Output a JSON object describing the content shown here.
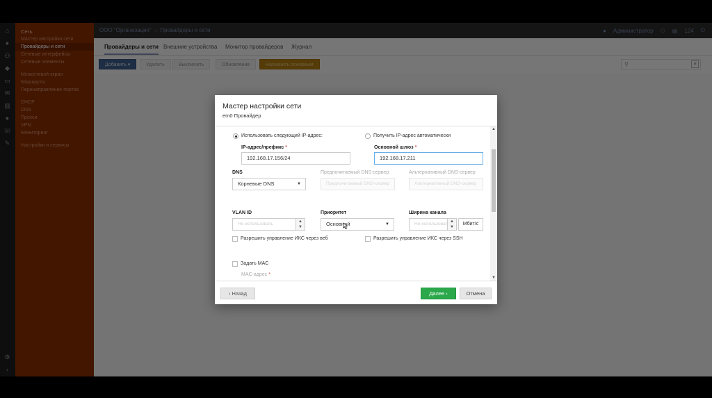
{
  "sidebar": {
    "items": [
      {
        "label": "Сеть",
        "kind": "head"
      },
      {
        "label": "Мастер настройки сети",
        "kind": "item"
      },
      {
        "label": "Провайдеры и сети",
        "kind": "active"
      },
      {
        "label": "Сетевые интерфейсы",
        "kind": "item"
      },
      {
        "label": "Сетевые элементы",
        "kind": "item"
      },
      {
        "label": "",
        "kind": "gap"
      },
      {
        "label": "Межсетевой экран",
        "kind": "item"
      },
      {
        "label": "Маршруты",
        "kind": "item"
      },
      {
        "label": "Перенаправление портов",
        "kind": "item"
      },
      {
        "label": "",
        "kind": "gap"
      },
      {
        "label": "DHCP",
        "kind": "item"
      },
      {
        "label": "DNS",
        "kind": "item"
      },
      {
        "label": "Прокси",
        "kind": "item"
      },
      {
        "label": "VPN",
        "kind": "item"
      },
      {
        "label": "Мониторинг",
        "kind": "item"
      },
      {
        "label": "",
        "kind": "gap"
      },
      {
        "label": "Настройки и сервисы",
        "kind": "item"
      }
    ]
  },
  "header": {
    "crumb_org": "ООО \"Организация\"",
    "crumb_sep": "→",
    "crumb_page": "Провайдеры и сети",
    "user": "Администратор",
    "counter": "124"
  },
  "tabs": [
    {
      "label": "Провайдеры и сети",
      "active": true
    },
    {
      "label": "Внешние устройства",
      "active": false
    },
    {
      "label": "Монитор провайдеров",
      "active": false
    },
    {
      "label": "Журнал",
      "active": false
    }
  ],
  "toolbar": {
    "add": "Добавить ▾",
    "edit": "Удалить",
    "disable": "Выключить",
    "refresh": "Обновление",
    "default": "Назначить основным"
  },
  "modal": {
    "title": "Мастер настройки сети",
    "subtitle": "em0 Провайдер",
    "radio_static": "Использовать следующий IP-адрес:",
    "radio_auto": "Получить IP-адрес автоматически",
    "ip_label": "IP-адрес/префикс",
    "ip_value": "192.168.17.156/24",
    "gw_label": "Основной шлюз",
    "gw_value": "192.168.17.211",
    "dns_label": "DNS",
    "dns_value": "Корневые DNS",
    "dns_pref_label": "Предпочитаемый DNS-сервер",
    "dns_pref_ph": "Предпочитаемый DNS-сервер",
    "dns_alt_label": "Альтернативный DNS-сервер",
    "dns_alt_ph": "Альтернативный DNS-сервер",
    "vlan_label": "VLAN ID",
    "vlan_ph": "Не использовать",
    "prio_label": "Приоритет",
    "prio_value": "Основной",
    "bw_label": "Ширина канала",
    "bw_ph": "Не использовать",
    "bw_unit": "Мбит/с",
    "cb_web": "Разрешить управление ИКС через веб",
    "cb_ssh": "Разрешить управление ИКС через SSH",
    "cb_mac": "Задать MAC",
    "mac_label": "MAC-адрес",
    "required_mark": "*",
    "back": "Назад",
    "next": "Далее",
    "cancel": "Отмена"
  },
  "colors": {
    "sidebar_bg": "#862c00",
    "primary": "#3b5a86",
    "next_green": "#2aa84a"
  }
}
